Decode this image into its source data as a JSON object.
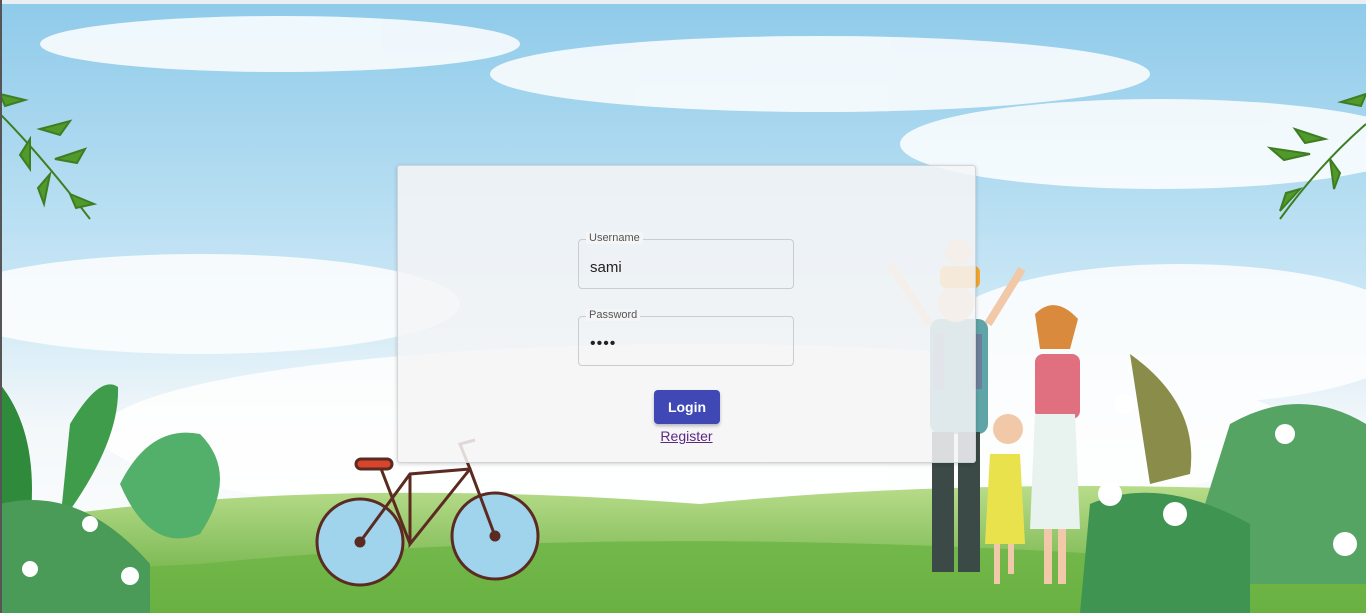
{
  "login_form": {
    "username": {
      "label": "Username",
      "value": "sami"
    },
    "password": {
      "label": "Password",
      "value": "sami"
    },
    "login_label": "Login",
    "register_label": "Register"
  },
  "colors": {
    "primary_button": "#3f48b5",
    "link": "#5a2a82",
    "sky": "#8ecbec",
    "grass": "#7fbf4b"
  }
}
